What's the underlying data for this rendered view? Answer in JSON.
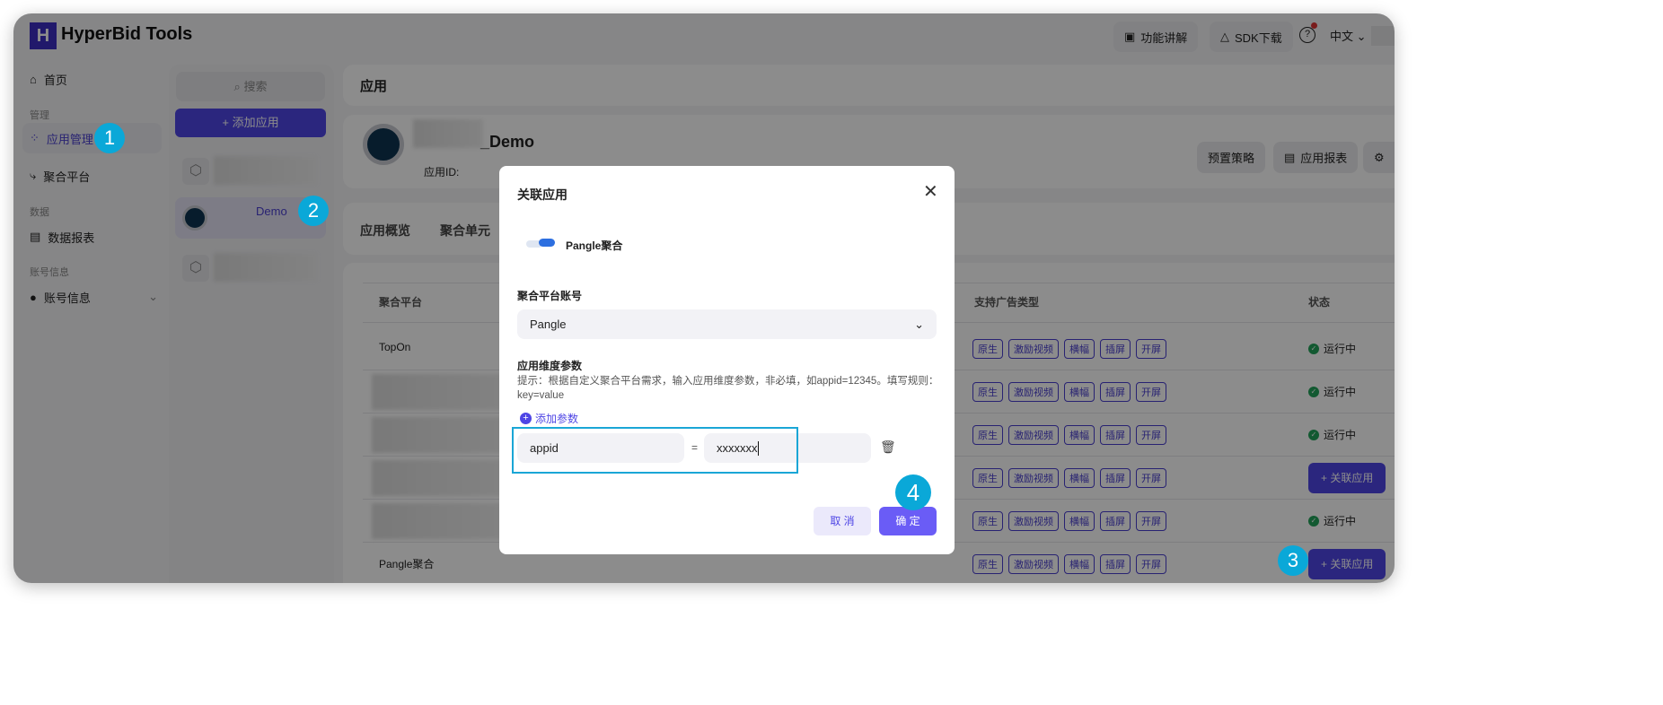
{
  "header": {
    "brand": "HyperBid Tools",
    "logo": "H",
    "features_btn": "功能讲解",
    "sdk_btn": "SDK下载",
    "language": "中文"
  },
  "sidebar": {
    "home": "首页",
    "section_manage": "管理",
    "app_manage": "应用管理",
    "mediation": "聚合平台",
    "section_data": "数据",
    "data_report": "数据报表",
    "section_account": "账号信息",
    "account_info": "账号信息"
  },
  "app_list": {
    "search_placeholder": "搜索",
    "add_app": "+ 添加应用",
    "selected_app_name": "Demo"
  },
  "main": {
    "title": "应用",
    "app_name": "_Demo",
    "app_id_label": "应用ID:",
    "preset_strategy": "预置策略",
    "app_report": "应用报表",
    "tabs": [
      "应用概览",
      "聚合单元"
    ],
    "table": {
      "headers": [
        "聚合平台",
        "支持广告类型",
        "状态"
      ],
      "ad_types": [
        "原生",
        "激励视频",
        "横幅",
        "插屏",
        "开屏"
      ],
      "rows": [
        {
          "platform": "TopOn",
          "status": "运行中"
        },
        {
          "platform": "",
          "status": "运行中"
        },
        {
          "platform": "",
          "status": "运行中"
        },
        {
          "platform": "",
          "action": "+ 关联应用"
        },
        {
          "platform": "",
          "status": "运行中"
        },
        {
          "platform": "Pangle聚合",
          "action": "+ 关联应用"
        }
      ]
    }
  },
  "modal": {
    "title": "关联应用",
    "platform_name": "Pangle聚合",
    "account_label": "聚合平台账号",
    "account_value": "Pangle",
    "params_label": "应用维度参数",
    "hint": "提示：根据自定义聚合平台需求，输入应用维度参数，非必填，如appid=12345。填写规则：key=value",
    "add_param": "添加参数",
    "param_key": "appid",
    "equals": "=",
    "param_value": "xxxxxxx",
    "cancel": "取 消",
    "confirm": "确 定"
  },
  "badges": [
    "1",
    "2",
    "3",
    "4"
  ],
  "colors": {
    "accent": "#4f46e5",
    "badge": "#0aa8d8",
    "running": "#22a35a"
  }
}
